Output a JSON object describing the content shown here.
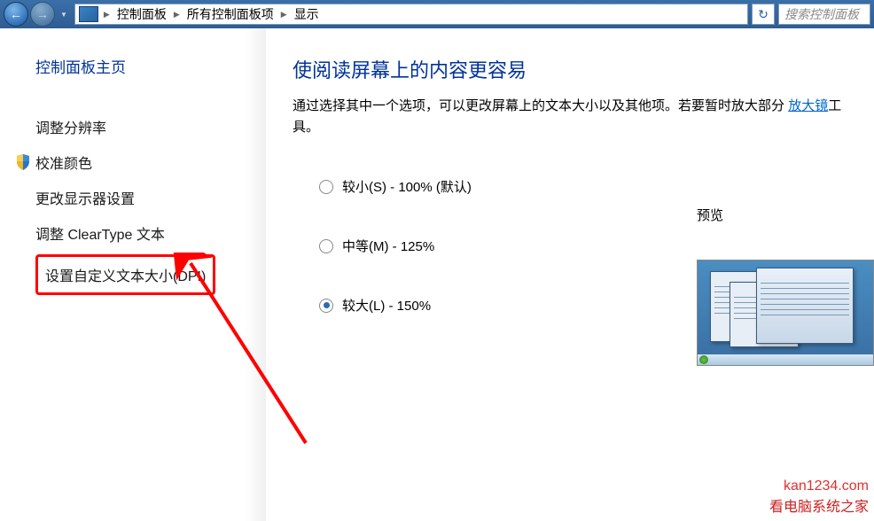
{
  "topbar": {
    "breadcrumb": [
      "控制面板",
      "所有控制面板项",
      "显示"
    ],
    "search_placeholder": "搜索控制面板"
  },
  "sidebar": {
    "title": "控制面板主页",
    "links": {
      "resolution": "调整分辨率",
      "calibrate": "校准颜色",
      "display_settings": "更改显示器设置",
      "cleartype": "调整 ClearType 文本",
      "dpi": "设置自定义文本大小(DPI)"
    }
  },
  "main": {
    "title": "使阅读屏幕上的内容更容易",
    "desc_part1": "通过选择其中一个选项，可以更改屏幕上的文本大小以及其他项。若要暂时放大部分",
    "magnifier_link": "放大镜",
    "desc_part2": "工具。",
    "options": {
      "small": "较小(S) - 100% (默认)",
      "medium": "中等(M) - 125%",
      "large": "较大(L) - 150%"
    },
    "preview_label": "预览"
  },
  "watermark": {
    "line1": "kan1234.com",
    "line2": "看电脑系统之家"
  }
}
